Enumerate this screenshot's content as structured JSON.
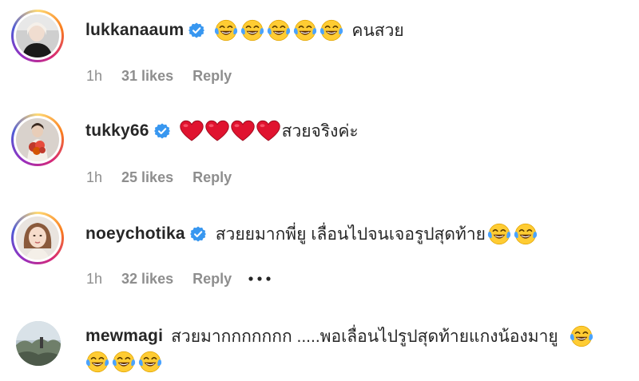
{
  "comments": [
    {
      "username": "lukkanaaum",
      "verified": true,
      "text": "คนสวย",
      "emoji_before_text": [
        "face-with-tears-of-joy-emoji",
        "face-with-tears-of-joy-emoji",
        "face-with-tears-of-joy-emoji",
        "face-with-tears-of-joy-emoji",
        "face-with-tears-of-joy-emoji"
      ],
      "time": "1h",
      "likes": "31 likes",
      "reply": "Reply"
    },
    {
      "username": "tukky66",
      "verified": true,
      "text": "สวยจริงค่ะ",
      "emoji_before_text": [
        "red-heart-emoji",
        "red-heart-emoji",
        "red-heart-emoji",
        "red-heart-emoji"
      ],
      "time": "1h",
      "likes": "25 likes",
      "reply": "Reply"
    },
    {
      "username": "noeychotika",
      "verified": true,
      "text": "สวยยมากพี่ยู เลื่อนไปจนเจอรูปสุดท้าย",
      "emoji_after_text": [
        "face-with-tears-of-joy-emoji",
        "face-with-tears-of-joy-emoji"
      ],
      "time": "1h",
      "likes": "32 likes",
      "reply": "Reply",
      "more_icon": "more-options-icon"
    },
    {
      "username": "mewmagi",
      "verified": false,
      "text": "สวยมากกกกกกก .....พอเลื่อนไปรูปสุดท้ายแกงน้องมายู",
      "emoji_after_text": [
        "face-with-tears-of-joy-emoji"
      ],
      "emoji_second_line": [
        "face-with-tears-of-joy-emoji",
        "face-with-tears-of-joy-emoji",
        "face-with-tears-of-joy-emoji"
      ]
    }
  ],
  "colors": {
    "username": "#262626",
    "meta": "#8e8e8e",
    "verified": "#3897f0",
    "emoji_face": "#ffcc33",
    "emoji_tears": "#4aa3ff",
    "heart": "#e0132f"
  }
}
